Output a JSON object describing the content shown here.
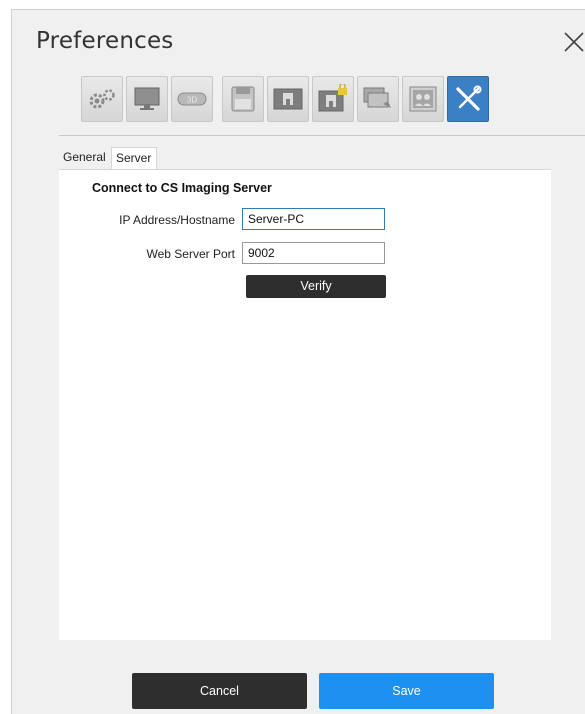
{
  "dialog": {
    "title": "Preferences"
  },
  "toolbar": {
    "buttons": [
      {
        "icon": "gears-icon"
      },
      {
        "icon": "monitor-icon"
      },
      {
        "icon": "3d-icon",
        "text": "3D"
      },
      {
        "icon": "save-disk-icon"
      },
      {
        "icon": "panoramic-xray-icon"
      },
      {
        "icon": "locked-xray-icon"
      },
      {
        "icon": "image-transfer-icon"
      },
      {
        "icon": "patient-photo-icon"
      },
      {
        "icon": "tools-icon",
        "active": true
      }
    ],
    "active_color": "#3b7fc4"
  },
  "tabs": [
    {
      "label": "General"
    },
    {
      "label": "Server",
      "active": true
    }
  ],
  "server": {
    "section_title": "Connect to CS Imaging Server",
    "ip_label": "IP Address/Hostname",
    "ip_value": "Server-PC",
    "port_label": "Web Server Port",
    "port_value": "9002",
    "verify_label": "Verify"
  },
  "footer": {
    "cancel_label": "Cancel",
    "save_label": "Save"
  },
  "colors": {
    "save": "#1e90f0",
    "dark_button": "#2e2e2e"
  }
}
